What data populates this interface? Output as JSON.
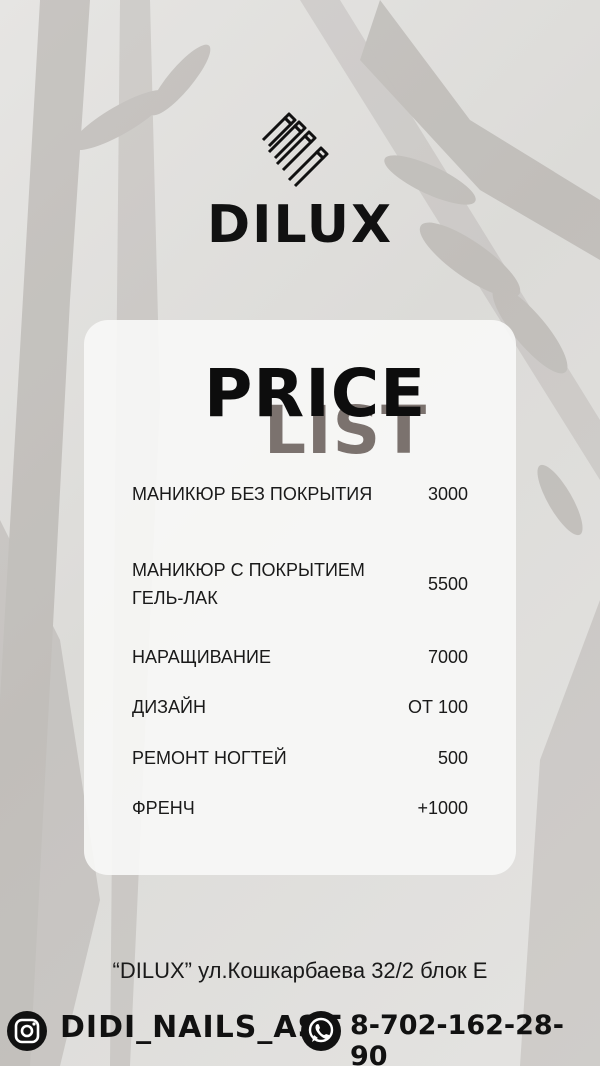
{
  "brand": {
    "name": "DILUX",
    "logo_icon": "nails-hand-icon"
  },
  "price_card": {
    "title_top": "PRICE",
    "title_bottom": "LIST",
    "items": [
      {
        "name": "МАНИКЮР БЕЗ ПОКРЫТИЯ",
        "price": "3000"
      },
      {
        "name": "МАНИКЮР С ПОКРЫТИЕМ ГЕЛЬ-ЛАК",
        "price": "5500"
      },
      {
        "name": "НАРАЩИВАНИЕ",
        "price": "7000"
      },
      {
        "name": "ДИЗАЙН",
        "price": "ОТ 100"
      },
      {
        "name": "РЕМОНТ НОГТЕЙ",
        "price": "500"
      },
      {
        "name": "ФРЕНЧ",
        "price": "+1000"
      }
    ]
  },
  "footer": {
    "address": "“DILUX” ул.Кошкарбаева 32/2 блок Е",
    "instagram_handle": "DIDI_NAILS_AST",
    "instagram_icon": "instagram-icon",
    "whatsapp_icon": "whatsapp-icon",
    "phone": "8-702-162-28-90"
  },
  "colors": {
    "text_dark": "#111111",
    "accent_list": "#7b726e",
    "card_bg": "#f8f8f7"
  }
}
